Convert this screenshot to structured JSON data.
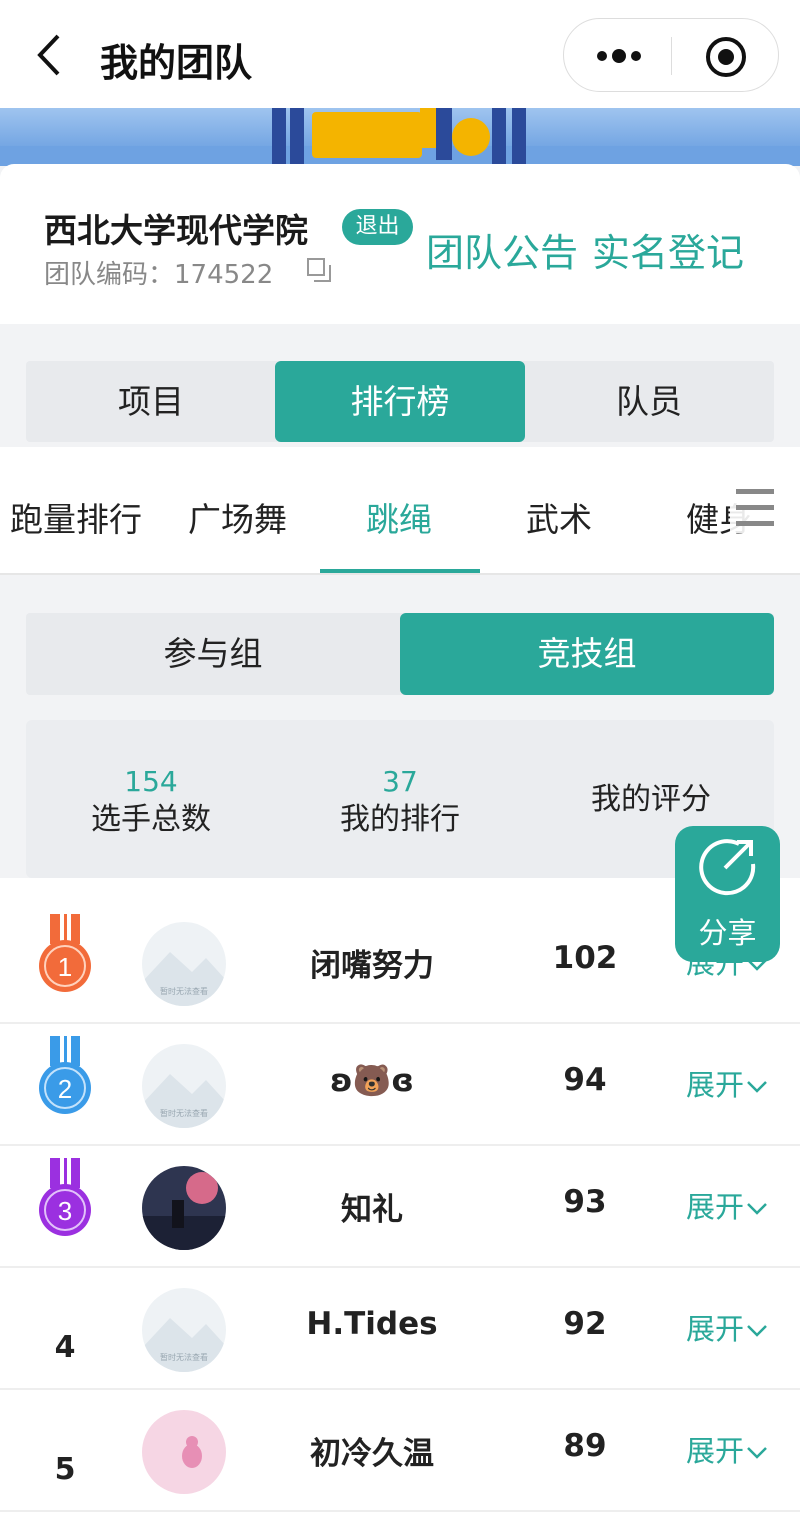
{
  "header": {
    "title": "我的团队"
  },
  "team": {
    "name": "西北大学现代学院",
    "quit_label": "退出",
    "code_label": "团队编码：",
    "code_value": "174522",
    "announcement_label": "团队公告",
    "realname_label": "实名登记"
  },
  "tabs": [
    "项目",
    "排行榜",
    "队员"
  ],
  "subtabs": [
    "跑量排行",
    "广场舞",
    "跳绳",
    "武术",
    "健身"
  ],
  "groups": [
    "参与组",
    "竞技组"
  ],
  "stats": {
    "total_num": "154",
    "total_label": "选手总数",
    "rank_num": "37",
    "rank_label": "我的排行",
    "score_label": "我的评分"
  },
  "share_label": "分享",
  "ranking": [
    {
      "rank": "1",
      "name": "闭嘴努力",
      "score": "102",
      "expand": "展开"
    },
    {
      "rank": "2",
      "name": "ʚ🐻ɞ",
      "score": "94",
      "expand": "展开"
    },
    {
      "rank": "3",
      "name": "知礼",
      "score": "93",
      "expand": "展开"
    },
    {
      "rank": "4",
      "name": "H.Tides",
      "score": "92",
      "expand": "展开"
    },
    {
      "rank": "5",
      "name": "初冷久温",
      "score": "89",
      "expand": "展开"
    }
  ],
  "avatar_placeholder_text": "暂时无法查看",
  "colors": {
    "accent": "#2aa89a",
    "gold": "#f26b3a",
    "silver": "#3a9be8",
    "bronze": "#9b30e0"
  }
}
